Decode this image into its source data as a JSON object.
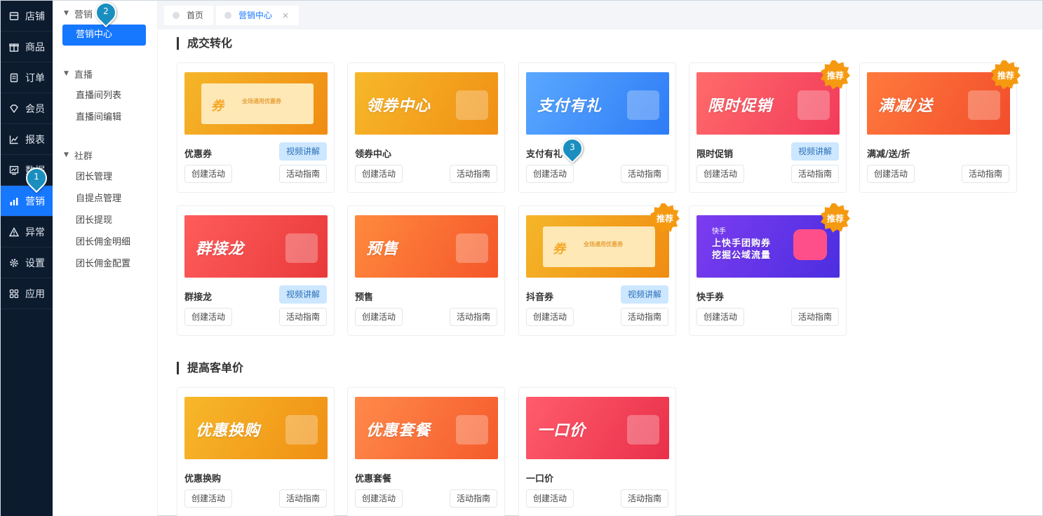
{
  "sidebar": {
    "items": [
      {
        "label": "店铺",
        "icon": "store-icon"
      },
      {
        "label": "商品",
        "icon": "gift-icon"
      },
      {
        "label": "订单",
        "icon": "order-icon"
      },
      {
        "label": "会员",
        "icon": "diamond-icon"
      },
      {
        "label": "报表",
        "icon": "report-icon"
      },
      {
        "label": "数据",
        "icon": "data-icon"
      },
      {
        "label": "营销",
        "icon": "bar-chart-icon",
        "active": true
      },
      {
        "label": "异常",
        "icon": "warning-icon"
      },
      {
        "label": "设置",
        "icon": "gear-icon"
      },
      {
        "label": "应用",
        "icon": "apps-icon"
      }
    ]
  },
  "submenu": {
    "groups": [
      {
        "title": "营销",
        "items": [
          "营销中心"
        ]
      },
      {
        "title": "直播",
        "items": [
          "直播间列表",
          "直播间编辑"
        ]
      },
      {
        "title": "社群",
        "items": [
          "团长管理",
          "自提点管理",
          "团长提现",
          "团长佣金明细",
          "团长佣金配置"
        ]
      }
    ]
  },
  "tabs": [
    {
      "label": "首页"
    },
    {
      "label": "营销中心",
      "active": true,
      "close": "×"
    }
  ],
  "sections": [
    {
      "title": "成交转化"
    },
    {
      "title": "提高客单价"
    }
  ],
  "buttons": {
    "create": "创建活动",
    "guide": "活动指南",
    "video": "视频讲解",
    "recommend": "推荐"
  },
  "cards": [
    {
      "name": "优惠券",
      "banner_text": "券",
      "banner_sub": "全场通用优惠券",
      "video": true,
      "recommend": false,
      "colors": [
        "#f5b629",
        "#f08c12"
      ]
    },
    {
      "name": "领券中心",
      "banner_text": "领券中心",
      "video": false,
      "recommend": false,
      "colors": [
        "#f7b82a",
        "#f08f14"
      ]
    },
    {
      "name": "支付有礼",
      "banner_text": "支付有礼",
      "video": false,
      "recommend": false,
      "colors": [
        "#5aa8ff",
        "#2e7cf6"
      ]
    },
    {
      "name": "限时促销",
      "banner_text": "限时促销",
      "video": true,
      "recommend": true,
      "colors": [
        "#ff6b6b",
        "#f23b5a"
      ]
    },
    {
      "name": "满减/送/折",
      "banner_text": "满减/送",
      "video": false,
      "recommend": true,
      "colors": [
        "#ff7a3d",
        "#f24d2c"
      ]
    },
    {
      "name": "群接龙",
      "banner_text": "群接龙",
      "video": true,
      "recommend": false,
      "colors": [
        "#ff5c5c",
        "#e93a3a"
      ]
    },
    {
      "name": "预售",
      "banner_text": "预售",
      "video": false,
      "recommend": false,
      "colors": [
        "#ff8a3d",
        "#f5562a"
      ]
    },
    {
      "name": "抖音券",
      "banner_text": "券",
      "banner_sub": "全场通用优惠券",
      "video": true,
      "recommend": true,
      "colors": [
        "#f5b629",
        "#f08c12"
      ]
    },
    {
      "name": "快手券",
      "banner_text": "上快手团购券 挖掘公域流量",
      "banner_logo": "快手",
      "video": false,
      "recommend": true,
      "colors": [
        "#7d3cf0",
        "#4b2ee0"
      ]
    },
    {
      "name": "优惠换购",
      "banner_text": "优惠换购",
      "video": false,
      "recommend": false,
      "colors": [
        "#f7b82a",
        "#f08f14"
      ]
    },
    {
      "name": "优惠套餐",
      "banner_text": "优惠套餐",
      "video": false,
      "recommend": false,
      "colors": [
        "#ff8a4a",
        "#f55a2c"
      ]
    },
    {
      "name": "一口价",
      "banner_text": "一口价",
      "video": false,
      "recommend": false,
      "colors": [
        "#ff5c6c",
        "#e9304a"
      ]
    }
  ],
  "markers": [
    "1",
    "2",
    "3"
  ]
}
